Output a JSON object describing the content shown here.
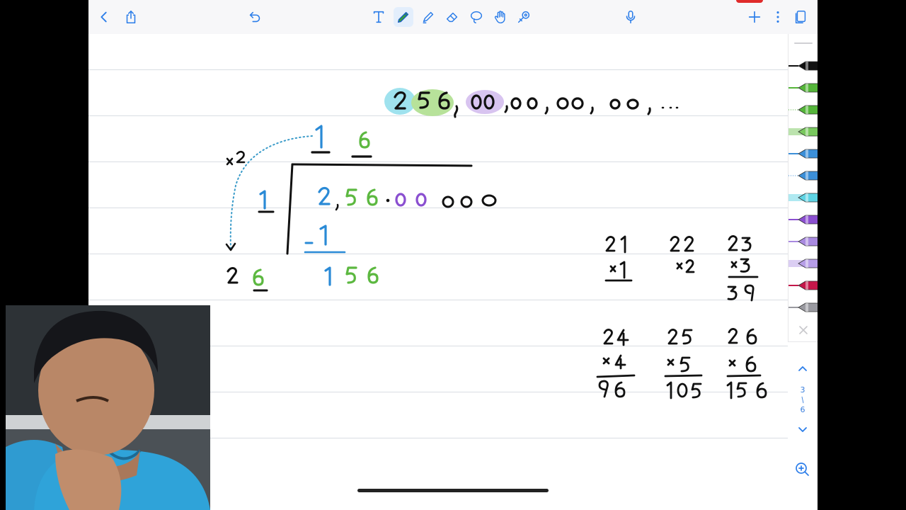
{
  "toolbar": {
    "left": [
      {
        "name": "back-chevron-icon"
      },
      {
        "name": "share-icon"
      },
      {
        "name": "undo-icon"
      }
    ],
    "tools": [
      {
        "name": "text-tool-icon"
      },
      {
        "name": "pen-tool-icon",
        "selected": true,
        "color": "#3aa13a"
      },
      {
        "name": "highlighter-tool-icon"
      },
      {
        "name": "eraser-tool-icon"
      },
      {
        "name": "lasso-tool-icon"
      },
      {
        "name": "hand-tool-icon"
      },
      {
        "name": "laser-pointer-tool-icon"
      }
    ],
    "right": [
      {
        "name": "microphone-icon"
      },
      {
        "name": "add-page-icon"
      },
      {
        "name": "more-vertical-icon"
      },
      {
        "name": "pages-overview-icon"
      }
    ]
  },
  "ink_colors": {
    "blue": "#2a8ad6",
    "green": "#5cb840",
    "purple": "#8a4fd0",
    "black": "#111111",
    "hl_cyan": "#9fe2ee",
    "hl_green": "#b7e29a",
    "hl_purple": "#d8c4f0",
    "dotted": "#3a9bc9"
  },
  "palette": [
    {
      "name": "pen-black",
      "color": "#111111"
    },
    {
      "name": "pen-green",
      "color": "#55b53a"
    },
    {
      "name": "pen-green-fine",
      "color": "#55b53a"
    },
    {
      "name": "highlighter-green",
      "color": "#79c85e"
    },
    {
      "name": "pen-blue",
      "color": "#3c8fd8"
    },
    {
      "name": "pen-blue-fine",
      "color": "#3c8fd8"
    },
    {
      "name": "highlighter-cyan",
      "color": "#5fd4e4"
    },
    {
      "name": "pen-purple",
      "color": "#8b4fd0"
    },
    {
      "name": "pen-lavender",
      "color": "#a98ae0"
    },
    {
      "name": "highlighter-lavender",
      "color": "#b79ee8"
    },
    {
      "name": "pen-crimson",
      "color": "#c4174a"
    },
    {
      "name": "pen-gray",
      "color": "#9a9aa0"
    }
  ],
  "page_nav": {
    "current": "3",
    "separator": "/",
    "total": "6"
  }
}
